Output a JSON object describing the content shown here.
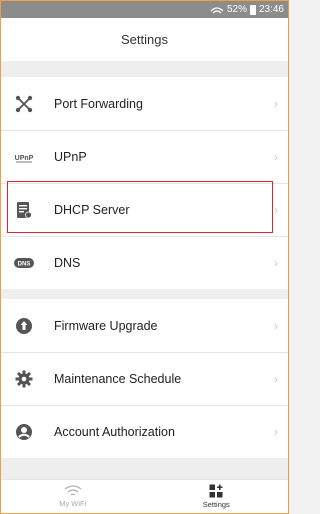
{
  "status_bar": {
    "battery": "52%",
    "time": "23:46"
  },
  "header": {
    "title": "Settings"
  },
  "group1": [
    {
      "label": "Port Forwarding",
      "icon": "port-forwarding-icon"
    },
    {
      "label": "UPnP",
      "icon": "upnp-icon",
      "icon_text": "UPnP"
    },
    {
      "label": "DHCP Server",
      "icon": "dhcp-server-icon",
      "highlighted": true
    },
    {
      "label": "DNS",
      "icon": "dns-icon",
      "icon_text": "DNS"
    }
  ],
  "group2": [
    {
      "label": "Firmware Upgrade",
      "icon": "firmware-upgrade-icon"
    },
    {
      "label": "Maintenance Schedule",
      "icon": "gear-icon"
    },
    {
      "label": "Account Authorization",
      "icon": "account-icon"
    }
  ],
  "tabbar": {
    "tabs": [
      {
        "label": "My WiFi",
        "active": false
      },
      {
        "label": "Settings",
        "active": true
      }
    ]
  },
  "colors": {
    "highlight": "#d9262c",
    "icon": "#555555",
    "chevron": "#c8c8c8"
  }
}
